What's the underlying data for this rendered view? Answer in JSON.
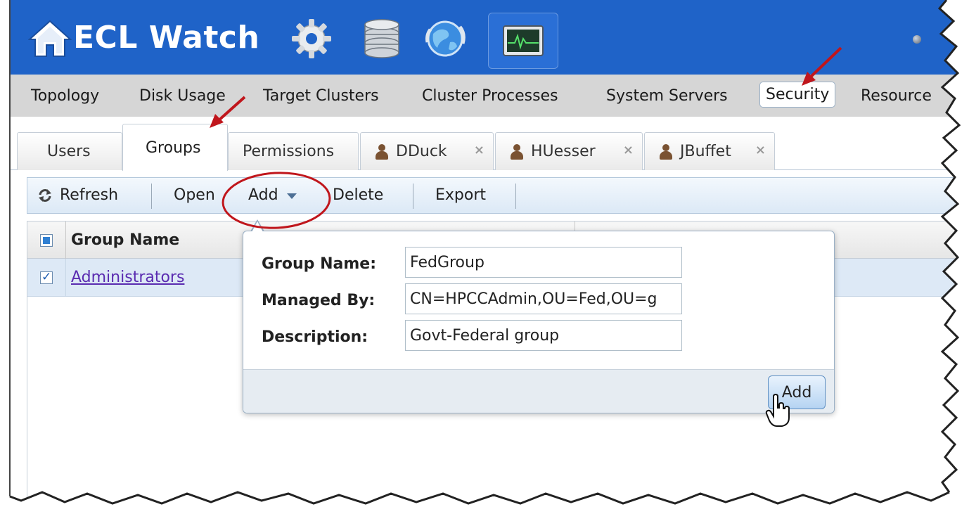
{
  "header": {
    "title": "ECL Watch",
    "icons": [
      "home-icon",
      "gear-icon",
      "database-icon",
      "globe-icon",
      "activity-monitor-icon"
    ],
    "background": "#1f63c8"
  },
  "nav": {
    "items": [
      {
        "label": "Topology",
        "active": false
      },
      {
        "label": "Disk Usage",
        "active": false
      },
      {
        "label": "Target Clusters",
        "active": false
      },
      {
        "label": "Cluster Processes",
        "active": false
      },
      {
        "label": "System Servers",
        "active": false
      },
      {
        "label": "Security",
        "active": true
      },
      {
        "label": "Resource",
        "active": false
      }
    ]
  },
  "tabs": [
    {
      "label": "Users",
      "active": false,
      "closable": false
    },
    {
      "label": "Groups",
      "active": true,
      "closable": false
    },
    {
      "label": "Permissions",
      "active": false,
      "closable": false
    },
    {
      "label": "DDuck",
      "active": false,
      "closable": true,
      "icon": "user-icon"
    },
    {
      "label": "HUesser",
      "active": false,
      "closable": true,
      "icon": "user-icon"
    },
    {
      "label": "JBuffet",
      "active": false,
      "closable": true,
      "icon": "user-icon"
    }
  ],
  "toolbar": {
    "refresh": "Refresh",
    "open": "Open",
    "add": "Add",
    "delete": "Delete",
    "export": "Export"
  },
  "grid": {
    "columns": [
      "Group Name"
    ],
    "rows": [
      {
        "name": "Administrators",
        "checked": true
      }
    ]
  },
  "popup": {
    "fields": [
      {
        "label": "Group Name:",
        "value": "FedGroup"
      },
      {
        "label": "Managed By:",
        "value": "CN=HPCCAdmin,OU=Fed,OU=g"
      },
      {
        "label": "Description:",
        "value": "Govt-Federal group"
      }
    ],
    "submit": "Add"
  },
  "colors": {
    "annotation": "#c0161c",
    "selection_row": "#dde9f6",
    "link": "#5a2bb0"
  }
}
